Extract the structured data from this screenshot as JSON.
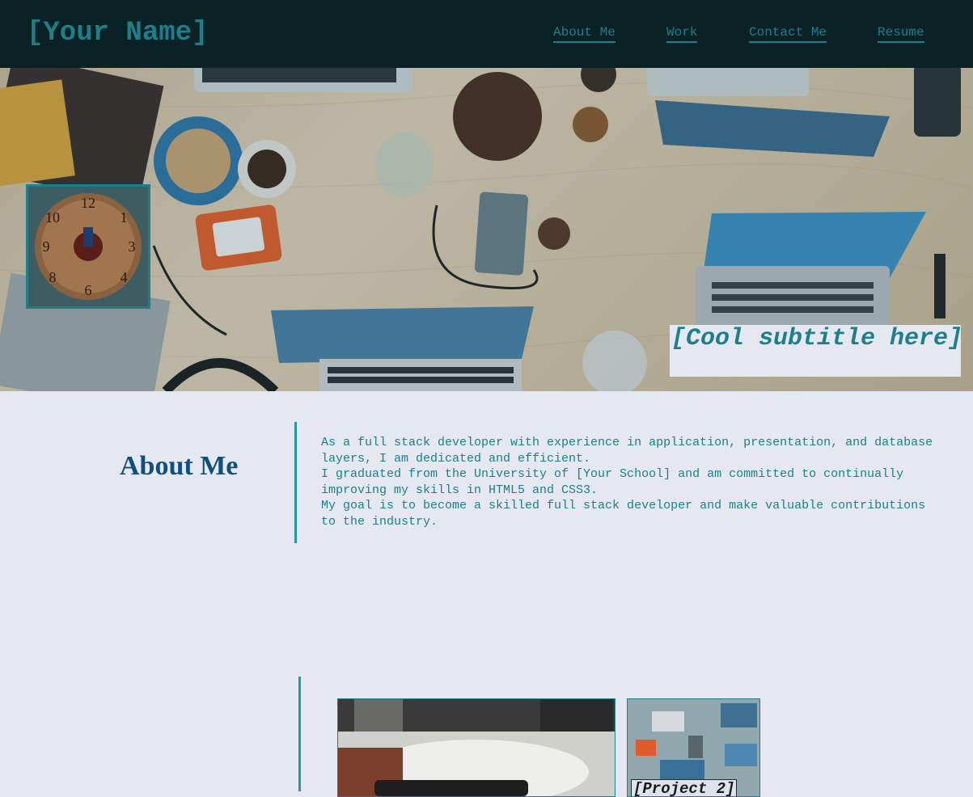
{
  "header": {
    "site_name": "[Your Name]",
    "nav": [
      {
        "label": "About Me"
      },
      {
        "label": "Work"
      },
      {
        "label": "Contact Me"
      },
      {
        "label": "Resume"
      }
    ]
  },
  "hero": {
    "subtitle": "[Cool subtitle here]"
  },
  "about": {
    "title": "About Me",
    "paragraphs": [
      "As a full stack developer with experience in application, presentation, and database layers, I am dedicated and efficient.",
      "I graduated from the University of [Your School] and am committed to continually improving my skills in HTML5 and CSS3.",
      "My goal is to become a skilled full stack developer and make valuable contributions to the industry."
    ]
  },
  "work": {
    "projects": [
      {
        "label": ""
      },
      {
        "label": "[Project 2]"
      }
    ]
  },
  "colors": {
    "header_bg": "#0a2226",
    "accent": "#1c7f8a",
    "page_bg": "#e5e8f0",
    "about_title": "#0f4f7a"
  }
}
